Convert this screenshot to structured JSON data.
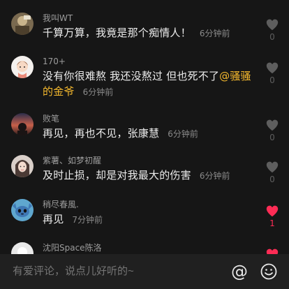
{
  "colors": {
    "background": "#161616",
    "username": "#9c9c9c",
    "content": "#ececec",
    "time": "#8a8a8a",
    "mention": "#f5b92e",
    "like_inactive": "#5e5e5e",
    "like_active": "#fe2c55",
    "input_bar": "#202020"
  },
  "comments": [
    {
      "username": "我叫WT",
      "content": "千算万算，我竟是那个痴情人！",
      "mention": "",
      "content_after": "",
      "time": "6分钟前",
      "likes": "0",
      "liked": false,
      "avatar_icon": "avatar-photo-icon"
    },
    {
      "username": "170+",
      "content": "没有你很难熬 我还没熬过 但也死不了",
      "mention": "@骚骚的金爷",
      "content_after": "",
      "time": "6分钟前",
      "likes": "0",
      "liked": false,
      "avatar_icon": "avatar-cartoon-girl-icon"
    },
    {
      "username": "败笔",
      "content": "再见，再也不见，张康慧",
      "mention": "",
      "content_after": "",
      "time": "6分钟前",
      "likes": "0",
      "liked": false,
      "avatar_icon": "avatar-sunset-silhouette-icon"
    },
    {
      "username": "紫薯、如梦初醒",
      "content": "及时止损，却是对我最大的伤害",
      "mention": "",
      "content_after": "",
      "time": "6分钟前",
      "likes": "0",
      "liked": false,
      "avatar_icon": "avatar-girl-portrait-icon"
    },
    {
      "username": "稍尽春風.",
      "content": "再见",
      "mention": "",
      "content_after": "",
      "time": "7分钟前",
      "likes": "1",
      "liked": true,
      "avatar_icon": "avatar-stitch-icon"
    },
    {
      "username": "沈阳Space陈洛",
      "content": "",
      "mention": "",
      "content_after": "",
      "time": "",
      "likes": "",
      "liked": true,
      "avatar_icon": "avatar-white-icon"
    }
  ],
  "input": {
    "placeholder": "有爱评论，说点儿好听的~"
  },
  "toolbar": {
    "at_label": "@",
    "at_icon": "at-sign-icon",
    "emoji_icon": "emoji-smile-icon"
  }
}
